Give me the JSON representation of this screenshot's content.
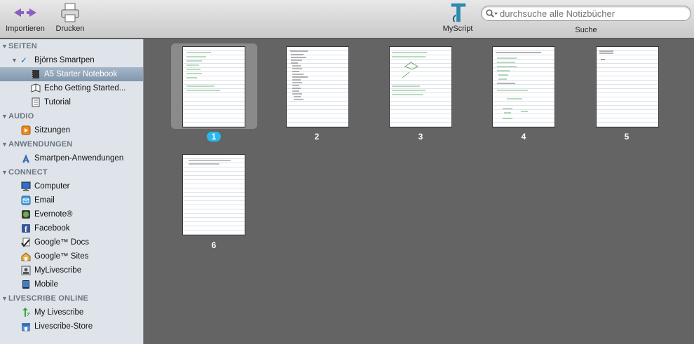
{
  "toolbar": {
    "import_label": "Importieren",
    "print_label": "Drucken",
    "myscript_label": "MyScript",
    "search_placeholder": "durchsuche alle Notizbücher",
    "search_label": "Suche"
  },
  "sidebar": {
    "sections": {
      "seiten": "SEITEN",
      "audio": "AUDIO",
      "anwendungen": "ANWENDUNGEN",
      "connect": "CONNECT",
      "online": "LIVESCRIBE ONLINE"
    },
    "pen": "Björns Smartpen",
    "notebooks": [
      "A5 Starter Notebook",
      "Echo Getting Started...",
      "Tutorial"
    ],
    "audio": [
      "Sitzungen"
    ],
    "apps": [
      "Smartpen-Anwendungen"
    ],
    "connect": [
      "Computer",
      "Email",
      "Evernote®",
      "Facebook",
      "Google™ Docs",
      "Google™ Sites",
      "MyLivescribe",
      "Mobile"
    ],
    "online": [
      "My Livescribe",
      "Livescribe-Store"
    ]
  },
  "pages": {
    "numbers": [
      "1",
      "2",
      "3",
      "4",
      "5",
      "6"
    ],
    "selected": 1
  },
  "colors": {
    "selection_badge": "#28b8f0",
    "sidebar_bg": "#dee4ea",
    "content_bg": "#646464"
  }
}
